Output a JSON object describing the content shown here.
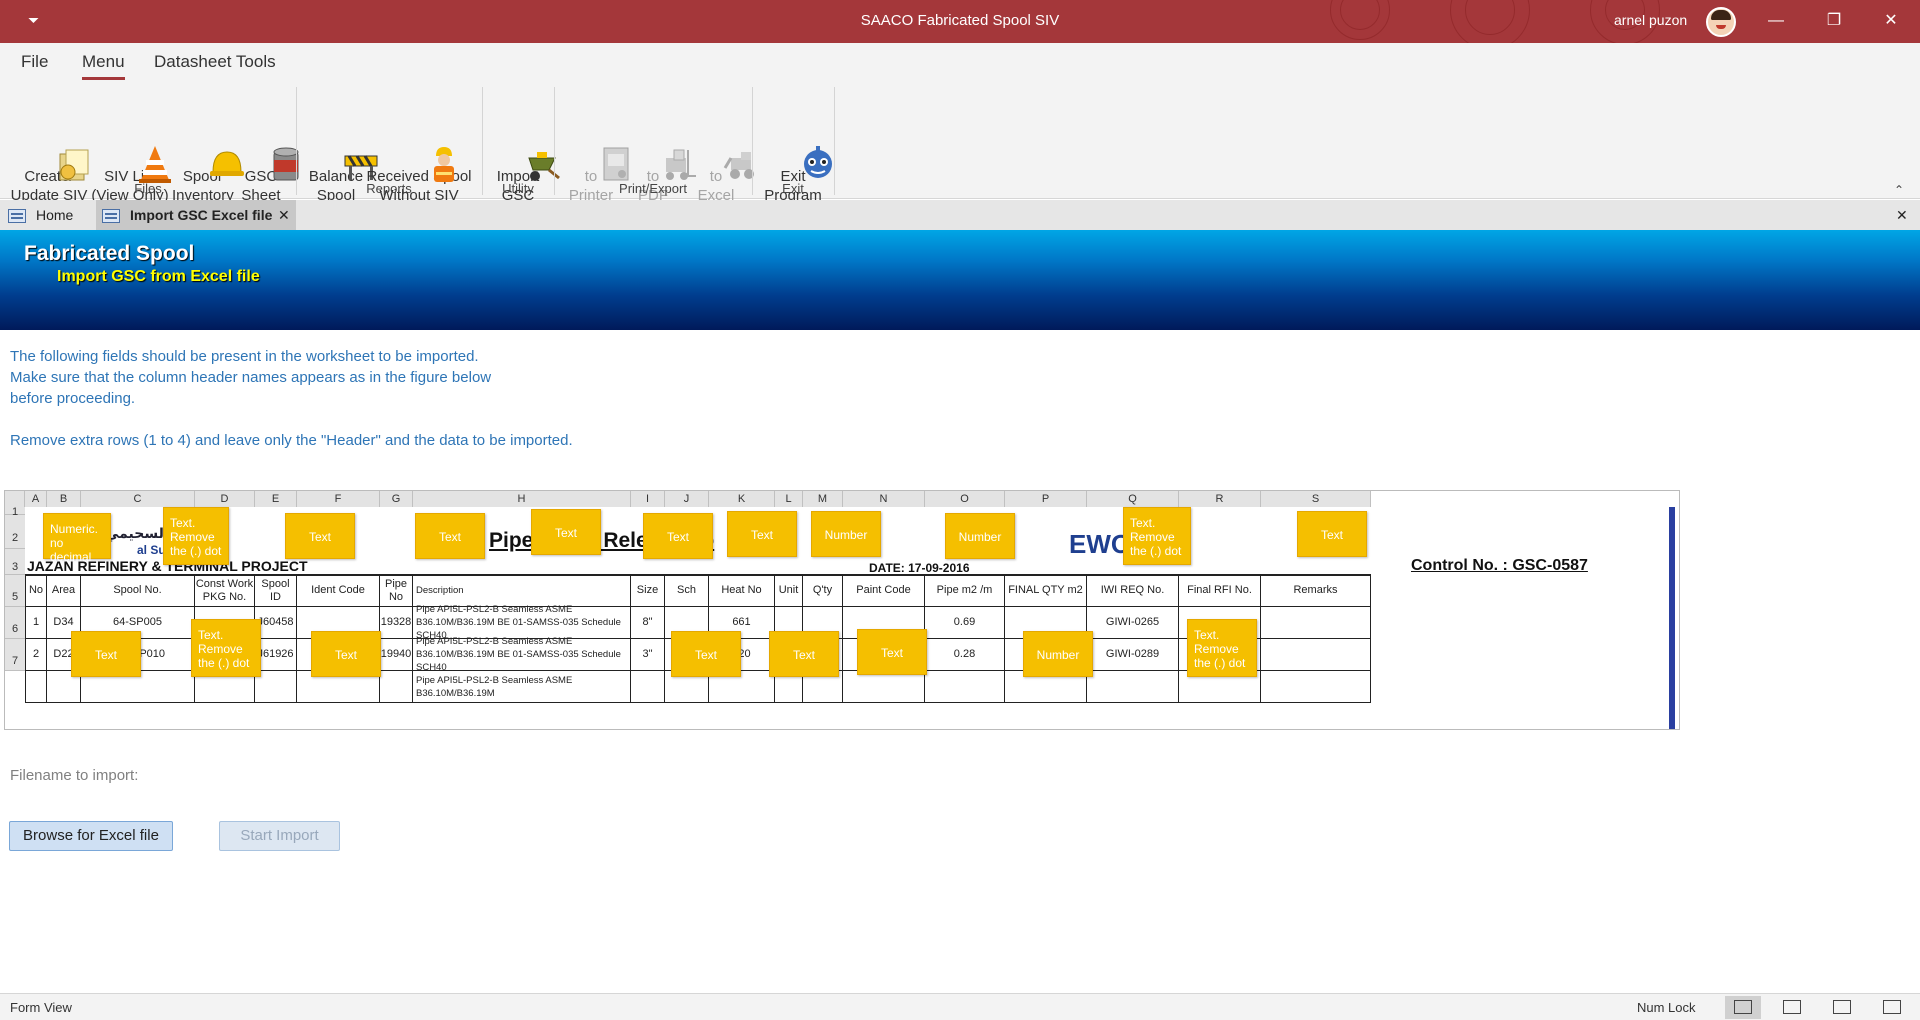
{
  "window": {
    "title": "SAACO Fabricated Spool SIV",
    "user": "arnel puzon",
    "qat_glyph": "⏷",
    "minimize": "—",
    "restore": "❐",
    "close": "✕"
  },
  "ribbon_tabs": [
    "File",
    "Menu",
    "Datasheet Tools"
  ],
  "ribbon": {
    "files": {
      "label": "Files",
      "buttons": [
        "Create/\nUpdate SIV",
        "SIV List\n(View Only)",
        "Spool\nInventory",
        "GSC\nSheet"
      ]
    },
    "reports": {
      "label": "Reports",
      "buttons": [
        "Balance\nSpool",
        "Received Spool\nWithout SIV"
      ]
    },
    "utility": {
      "label": "Utility",
      "buttons": [
        "Import\nGSC"
      ]
    },
    "print_export": {
      "label": "Print/Export",
      "buttons": [
        "to\nPrinter",
        "to\nPDF",
        "to\nExcel"
      ]
    },
    "exit": {
      "label": "Exit",
      "buttons": [
        "Exit\nProgram"
      ]
    },
    "collapse_glyph": "⌃"
  },
  "doc_tabs": {
    "home": "Home",
    "import": "Import GSC Excel file",
    "close_glyph": "✕"
  },
  "banner": {
    "title": "Fabricated Spool",
    "subtitle": "Import GSC from Excel file"
  },
  "instructions": {
    "line1": "The following fields should be present in the worksheet to be imported.",
    "line2": "Make sure that the column header names appears as in the figure below",
    "line3": "before proceeding.",
    "line4": "Remove extra rows (1 to 4) and leave only the \"Header\" and the data to be imported."
  },
  "sheet": {
    "col_letters": [
      "A",
      "B",
      "C",
      "D",
      "E",
      "F",
      "G",
      "H",
      "I",
      "J",
      "K",
      "L",
      "M",
      "N",
      "O",
      "P",
      "Q",
      "R",
      "S"
    ],
    "row_numbers": [
      "1",
      "2",
      "3",
      "5",
      "6",
      "7"
    ],
    "project": "JAZAN REFINERY & TERMINAL PROJECT",
    "logo_arabic": "جلوبال السحيمي",
    "logo_english": "al Suhaimi",
    "form_title_fragment": "Pipe/Spool Release Fo",
    "brand_fragment": "EWOO",
    "date": "DATE: 17-09-2016",
    "control_no": "Control No. :  GSC-0587",
    "headers": [
      "No",
      "Area",
      "Spool No.",
      "Const Work PKG No.",
      "Spool ID",
      "Ident Code",
      "Pipe No",
      "Description",
      "Size",
      "Sch",
      "Heat No",
      "Unit",
      "Q'ty",
      "Paint Code",
      "Pipe m2 /m",
      "FINAL QTY m2",
      "IWI REQ No.",
      "Final RFI No.",
      "Remarks"
    ],
    "rows": [
      [
        "1",
        "D34",
        "64-SP005",
        "",
        "J60458",
        "",
        "19328",
        "Pipe API5L-PSL2-B Seamless ASME B36.10M/B36.19M BE 01-SAMSS-035  Schedule SCH40",
        "8\"",
        "",
        "661",
        "",
        "",
        "",
        "0.69",
        "",
        "GIWI-0265",
        "",
        ""
      ],
      [
        "2",
        "D22",
        "724-SP010",
        "",
        "J61926",
        "",
        "19940",
        "Pipe API5L-PSL2-B Seamless ASME B36.10M/B36.19M BE 01-SAMSS-035  Schedule SCH40",
        "3\"",
        "",
        "920",
        "",
        "",
        "",
        "0.28",
        "",
        "GIWI-0289",
        "",
        ""
      ],
      [
        "",
        "",
        "",
        "",
        "",
        "",
        "",
        "Pipe API5L-PSL2-B Seamless ASME B36.10M/B36.19M",
        "",
        "",
        "",
        "",
        "",
        "",
        "",
        "",
        "",
        "",
        ""
      ]
    ],
    "callouts": [
      "Numeric. no decimal",
      "Text. Remove the (.) dot",
      "Text",
      "Text",
      "Text",
      "Text",
      "Number",
      "Number",
      "Text. Remove the (.) dot",
      "Text",
      "Text",
      "Text. Remove the (.) dot",
      "Text",
      "Text",
      "Text",
      "Text",
      "Number",
      "Text. Remove the (.) dot"
    ]
  },
  "filename_label": "Filename to import:",
  "buttons": {
    "browse": "Browse for Excel file",
    "start": "Start Import"
  },
  "status": {
    "view": "Form View",
    "numlock": "Num Lock"
  },
  "colors": {
    "titlebar": "#a4373a",
    "accent_link": "#2e75b6",
    "callout": "#f5bf00"
  }
}
